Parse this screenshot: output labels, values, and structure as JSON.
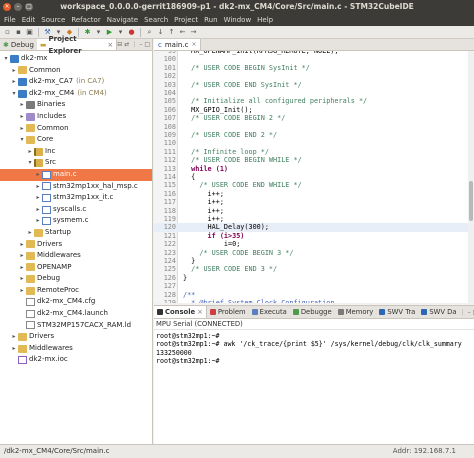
{
  "window": {
    "title": "workspace_0.0.0.0-gerrit186909-p1 - dk2-mx_CM4/Core/Src/main.c - STM32CubeIDE"
  },
  "menubar": [
    "File",
    "Edit",
    "Source",
    "Refactor",
    "Navigate",
    "Search",
    "Project",
    "Run",
    "Window",
    "Help"
  ],
  "left_panel": {
    "tabs": [
      {
        "label": "Debug",
        "active": false
      },
      {
        "label": "Project Explorer",
        "active": true
      }
    ],
    "tree": [
      {
        "label": "dk2-mx",
        "suffix": "",
        "depth": 0,
        "twisty": "▾",
        "icon": "proj"
      },
      {
        "label": "Common",
        "suffix": "",
        "depth": 1,
        "twisty": "▸",
        "icon": "folder"
      },
      {
        "label": "dk2-mx_CA7",
        "suffix": "(in CA7)",
        "depth": 1,
        "twisty": "▸",
        "icon": "proj"
      },
      {
        "label": "dk2-mx_CM4",
        "suffix": "(in CM4)",
        "depth": 1,
        "twisty": "▾",
        "icon": "proj"
      },
      {
        "label": "Binaries",
        "suffix": "",
        "depth": 2,
        "twisty": "▸",
        "icon": "bin"
      },
      {
        "label": "Includes",
        "suffix": "",
        "depth": 2,
        "twisty": "▸",
        "icon": "incl"
      },
      {
        "label": "Common",
        "suffix": "",
        "depth": 2,
        "twisty": "▸",
        "icon": "folder"
      },
      {
        "label": "Core",
        "suffix": "",
        "depth": 2,
        "twisty": "▾",
        "icon": "folder"
      },
      {
        "label": "Inc",
        "suffix": "",
        "depth": 3,
        "twisty": "▸",
        "icon": "src"
      },
      {
        "label": "Src",
        "suffix": "",
        "depth": 3,
        "twisty": "▾",
        "icon": "src"
      },
      {
        "label": "main.c",
        "suffix": "",
        "depth": 4,
        "twisty": "▸",
        "icon": "cfile",
        "selected": true
      },
      {
        "label": "stm32mp1xx_hal_msp.c",
        "suffix": "",
        "depth": 4,
        "twisty": "▸",
        "icon": "cfile"
      },
      {
        "label": "stm32mp1xx_it.c",
        "suffix": "",
        "depth": 4,
        "twisty": "▸",
        "icon": "cfile"
      },
      {
        "label": "syscalls.c",
        "suffix": "",
        "depth": 4,
        "twisty": "▸",
        "icon": "cfile"
      },
      {
        "label": "sysmem.c",
        "suffix": "",
        "depth": 4,
        "twisty": "▸",
        "icon": "cfile"
      },
      {
        "label": "Startup",
        "suffix": "",
        "depth": 3,
        "twisty": "▸",
        "icon": "folder"
      },
      {
        "label": "Drivers",
        "suffix": "",
        "depth": 2,
        "twisty": "▸",
        "icon": "folder"
      },
      {
        "label": "Middlewares",
        "suffix": "",
        "depth": 2,
        "twisty": "▸",
        "icon": "folder"
      },
      {
        "label": "OPENAMP",
        "suffix": "",
        "depth": 2,
        "twisty": "▸",
        "icon": "folder"
      },
      {
        "label": "Debug",
        "suffix": "",
        "depth": 2,
        "twisty": "▸",
        "icon": "folder"
      },
      {
        "label": "RemoteProc",
        "suffix": "",
        "depth": 2,
        "twisty": "▸",
        "icon": "folder"
      },
      {
        "label": "dk2-mx_CM4.cfg",
        "suffix": "",
        "depth": 2,
        "twisty": "",
        "icon": "file"
      },
      {
        "label": "dk2-mx_CM4.launch",
        "suffix": "",
        "depth": 2,
        "twisty": "",
        "icon": "file"
      },
      {
        "label": "STM32MP157CACX_RAM.ld",
        "suffix": "",
        "depth": 2,
        "twisty": "",
        "icon": "file"
      },
      {
        "label": "Drivers",
        "suffix": "",
        "depth": 1,
        "twisty": "▸",
        "icon": "folder"
      },
      {
        "label": "Middlewares",
        "suffix": "",
        "depth": 1,
        "twisty": "▸",
        "icon": "folder"
      },
      {
        "label": "dk2-mx.ioc",
        "suffix": "",
        "depth": 1,
        "twisty": "",
        "icon": "hfile"
      }
    ]
  },
  "editor": {
    "tab_label": "main.c",
    "lines": [
      {
        "n": "99",
        "text": "  MX_OPENAMP_Init(RPMSG_REMOTE, NULL);",
        "cls": ""
      },
      {
        "n": "100",
        "text": "",
        "cls": ""
      },
      {
        "n": "101",
        "text": "  /* USER CODE BEGIN SysInit */",
        "cls": "comment"
      },
      {
        "n": "102",
        "text": "",
        "cls": ""
      },
      {
        "n": "103",
        "text": "  /* USER CODE END SysInit */",
        "cls": "comment"
      },
      {
        "n": "104",
        "text": "",
        "cls": ""
      },
      {
        "n": "105",
        "text": "  /* Initialize all configured peripherals */",
        "cls": "comment"
      },
      {
        "n": "106",
        "text": "  MX_GPIO_Init();",
        "cls": ""
      },
      {
        "n": "107",
        "text": "  /* USER CODE BEGIN 2 */",
        "cls": "comment"
      },
      {
        "n": "108",
        "text": "",
        "cls": ""
      },
      {
        "n": "109",
        "text": "  /* USER CODE END 2 */",
        "cls": "comment"
      },
      {
        "n": "110",
        "text": "",
        "cls": ""
      },
      {
        "n": "111",
        "text": "  /* Infinite loop */",
        "cls": "comment"
      },
      {
        "n": "112",
        "text": "  /* USER CODE BEGIN WHILE */",
        "cls": "comment"
      },
      {
        "n": "113",
        "text": "  while (1)",
        "cls": "kw"
      },
      {
        "n": "114",
        "text": "  {",
        "cls": ""
      },
      {
        "n": "115",
        "text": "    /* USER CODE END WHILE */",
        "cls": "comment"
      },
      {
        "n": "116",
        "text": "      i++;",
        "cls": ""
      },
      {
        "n": "117",
        "text": "      i++;",
        "cls": ""
      },
      {
        "n": "118",
        "text": "      i++;",
        "cls": ""
      },
      {
        "n": "119",
        "text": "      i++;",
        "cls": ""
      },
      {
        "n": "120",
        "text": "      HAL_Delay(300);",
        "cls": "",
        "current": true
      },
      {
        "n": "121",
        "text": "      if (i>35)",
        "cls": "kw"
      },
      {
        "n": "122",
        "text": "          i=0;",
        "cls": ""
      },
      {
        "n": "123",
        "text": "    /* USER CODE BEGIN 3 */",
        "cls": "comment"
      },
      {
        "n": "124",
        "text": "  }",
        "cls": ""
      },
      {
        "n": "125",
        "text": "  /* USER CODE END 3 */",
        "cls": "comment"
      },
      {
        "n": "126",
        "text": "}",
        "cls": ""
      },
      {
        "n": "127",
        "text": "",
        "cls": ""
      },
      {
        "n": "128",
        "text": "/**",
        "cls": "doc"
      },
      {
        "n": "129",
        "text": "  * @brief System Clock Configuration",
        "cls": "doc"
      },
      {
        "n": "130",
        "text": "  * @retval None",
        "cls": "doc"
      }
    ]
  },
  "console": {
    "tabs": [
      {
        "label": "Console",
        "active": true,
        "color": "#333333"
      },
      {
        "label": "Problem",
        "active": false,
        "color": "#c94040"
      },
      {
        "label": "Executa",
        "active": false,
        "color": "#5a7fc0"
      },
      {
        "label": "Debugge",
        "active": false,
        "color": "#4e9a4e"
      },
      {
        "label": "Memory",
        "active": false,
        "color": "#7a7a7a"
      },
      {
        "label": "SWV Tra",
        "active": false,
        "color": "#2d66b5"
      },
      {
        "label": "SWV Da",
        "active": false,
        "color": "#2d66b5"
      }
    ],
    "subtitle": "MPU Serial (CONNECTED)",
    "lines": [
      "root@stm32mp1:~#",
      "root@stm32mp1:~# awk '/ck_trace/{print $5}' /sys/kernel/debug/clk/clk_summary",
      "133250000",
      "root@stm32mp1:~#"
    ]
  },
  "statusbar": {
    "left": "/dk2-mx_CM4/Core/Src/main.c",
    "right": "Addr: 192.168.7.1"
  }
}
